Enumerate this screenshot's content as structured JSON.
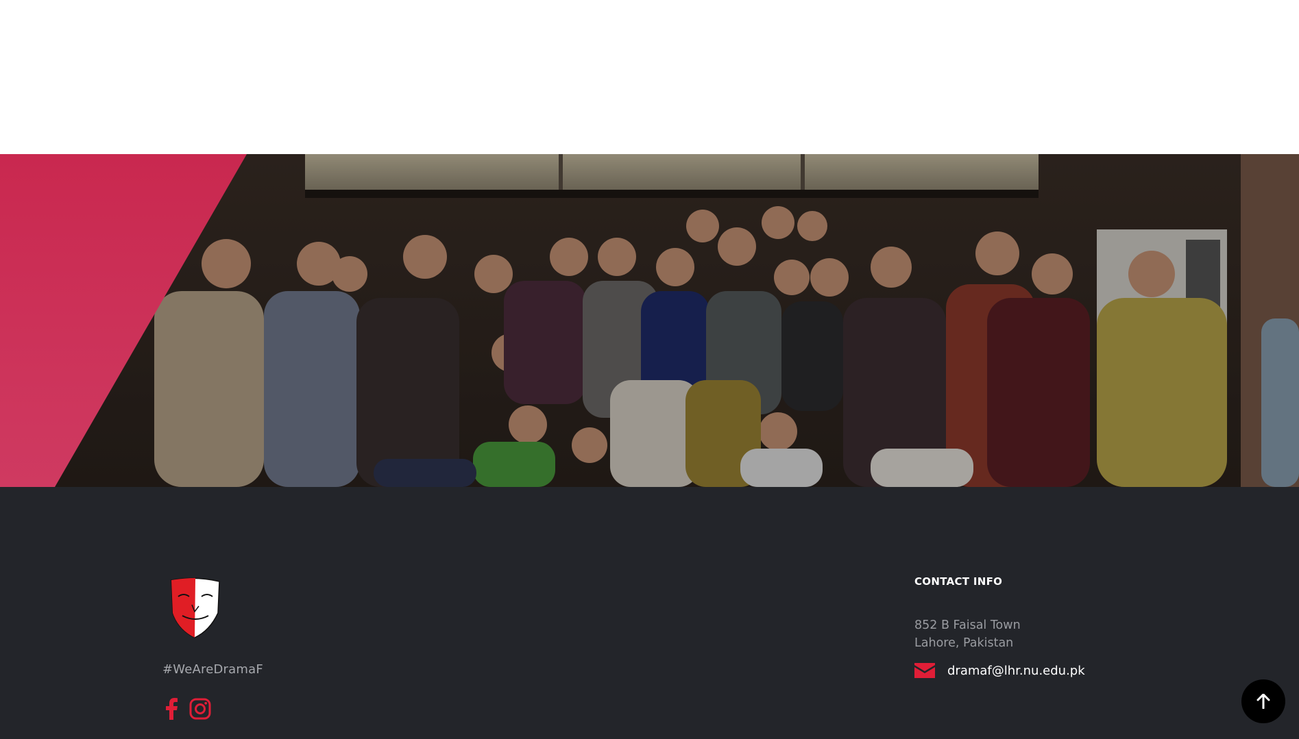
{
  "hero": {
    "accent_color": "#cf2d56",
    "photo_description": "group-photo"
  },
  "footer": {
    "background": "#23252a",
    "logo_icon": "drama-mask-shield-icon",
    "tagline": "#WeAreDramaF",
    "social": [
      {
        "icon": "facebook-icon"
      },
      {
        "icon": "instagram-icon"
      }
    ],
    "contact": {
      "heading": "CONTACT INFO",
      "address_line1": "852 B Faisal Town",
      "address_line2": "Lahore, Pakistan",
      "email_icon": "envelope-icon",
      "email": "dramaf@lhr.nu.edu.pk"
    },
    "accent_color": "#e01e37"
  },
  "back_to_top": {
    "icon": "arrow-up-icon"
  }
}
